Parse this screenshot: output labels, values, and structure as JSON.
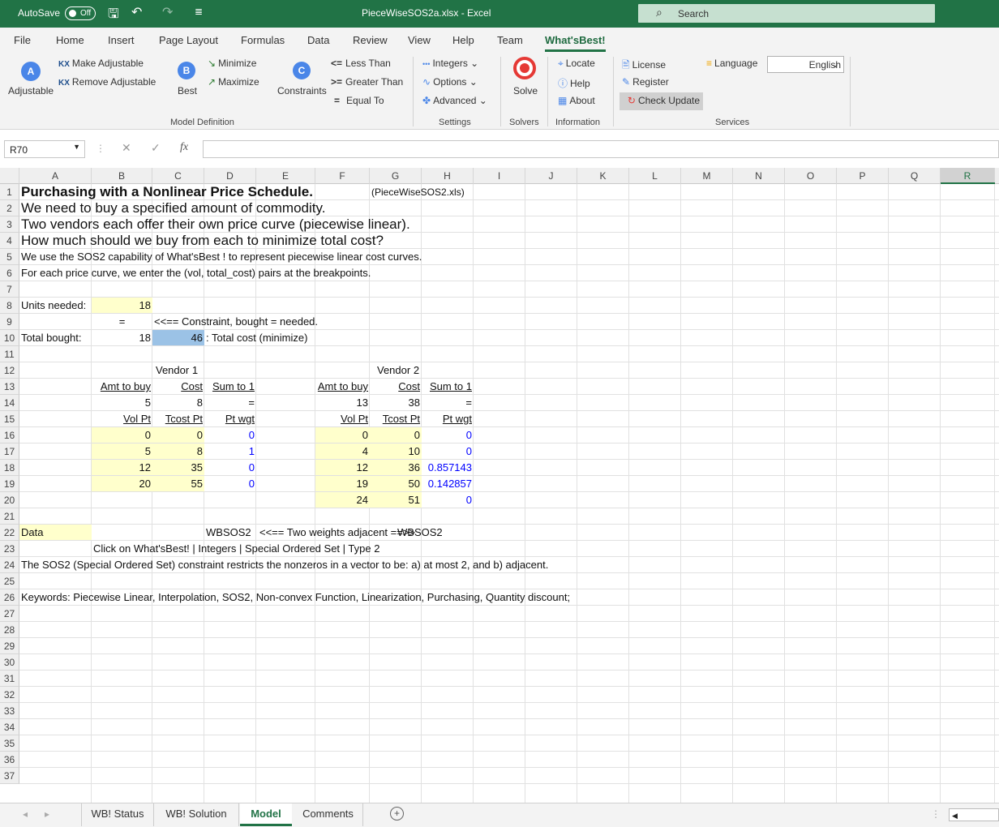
{
  "titlebar": {
    "autosave": "AutoSave",
    "toggle": "Off",
    "title": "PieceWiseSOS2a.xlsx  -  Excel",
    "search": "Search"
  },
  "menu": [
    "File",
    "Home",
    "Insert",
    "Page Layout",
    "Formulas",
    "Data",
    "Review",
    "View",
    "Help",
    "Team",
    "What'sBest!"
  ],
  "ribbon": {
    "adjustable": "Adjustable",
    "make_adj": "Make Adjustable",
    "remove_adj": "Remove Adjustable",
    "best": "Best",
    "minimize": "Minimize",
    "maximize": "Maximize",
    "constraints": "Constraints",
    "less": "Less Than",
    "greater": "Greater Than",
    "equal": "Equal To",
    "integers": "Integers",
    "options": "Options",
    "advanced": "Advanced",
    "solve": "Solve",
    "locate": "Locate",
    "help": "Help",
    "about": "About",
    "license": "License",
    "register": "Register",
    "check_update": "Check Update",
    "language": "Language",
    "language_value": "English",
    "groups": {
      "model_def": "Model Definition",
      "settings": "Settings",
      "solvers": "Solvers",
      "information": "Information",
      "services": "Services"
    }
  },
  "formula": {
    "namebox": "R70",
    "fx": "fx",
    "value": ""
  },
  "columns": [
    "A",
    "B",
    "C",
    "D",
    "E",
    "F",
    "G",
    "H",
    "I",
    "J",
    "K",
    "L",
    "M",
    "N",
    "O",
    "P",
    "Q",
    "R"
  ],
  "rows": [
    "1",
    "2",
    "3",
    "4",
    "5",
    "6",
    "7",
    "8",
    "9",
    "10",
    "11",
    "12",
    "13",
    "14",
    "15",
    "16",
    "17",
    "18",
    "19",
    "20",
    "21",
    "22",
    "23",
    "24",
    "25",
    "26",
    "27",
    "28",
    "29",
    "30",
    "31",
    "32",
    "33",
    "34",
    "35",
    "36",
    "37"
  ],
  "cells": {
    "a1": "Purchasing with a Nonlinear Price Schedule.",
    "g1": "(PieceWiseSOS2.xls)",
    "a2": "We need to buy a specified amount of commodity.",
    "a3": "Two vendors each offer their own price curve (piecewise linear).",
    "a4": "How much should we buy from each to minimize total cost?",
    "a5": "  We use the SOS2 capability of What'sBest ! to represent piecewise linear cost curves.",
    "a6": "For each price curve, we enter the (vol, total_cost) pairs at the breakpoints.",
    "a8": "Units needed:",
    "b8": "18",
    "b9": "=",
    "c9": "<<== Constraint, bought = needed.",
    "a10": "Total bought:",
    "b10": "18",
    "c10": "46",
    "d10": ": Total cost (minimize)",
    "v1": "Vendor 1",
    "v2": "Vendor 2",
    "amt": "Amt to buy",
    "cost": "Cost",
    "sum": "Sum to 1",
    "b14": "5",
    "c14": "8",
    "d14": "=",
    "f14": "13",
    "g14": "38",
    "h14": "=",
    "volpt": "Vol Pt",
    "tcost": "Tcost Pt",
    "ptwgt": "Pt wgt",
    "v1rows": [
      [
        "0",
        "0",
        "0"
      ],
      [
        "5",
        "8",
        "1"
      ],
      [
        "12",
        "35",
        "0"
      ],
      [
        "20",
        "55",
        "0"
      ]
    ],
    "v2rows": [
      [
        "0",
        "0",
        "0"
      ],
      [
        "4",
        "10",
        "0"
      ],
      [
        "12",
        "36",
        "0.857143"
      ],
      [
        "19",
        "50",
        "0.142857"
      ],
      [
        "24",
        "51",
        "0"
      ]
    ],
    "a22": "Data",
    "d22": "WBSOS2",
    "e22": "<<== Two weights adjacent ==>>",
    "h22": "WBSOS2",
    "b23": "Click on What'sBest! | Integers | Special Ordered Set  |  Type 2",
    "a24": "The SOS2 (Special Ordered Set) constraint restricts the nonzeros in a vector to be: a) at most 2, and b) adjacent.",
    "a26": "Keywords: Piecewise Linear, Interpolation, SOS2, Non-convex Function, Linearization, Purchasing, Quantity discount;"
  },
  "tabs": [
    "WB! Status",
    "WB! Solution",
    "Model",
    "Comments"
  ],
  "colors": {
    "excel_green": "#217346",
    "input_yellow": "#ffffcc",
    "selected_blue": "#9bc2e6",
    "blue_text": "#0000ff"
  }
}
